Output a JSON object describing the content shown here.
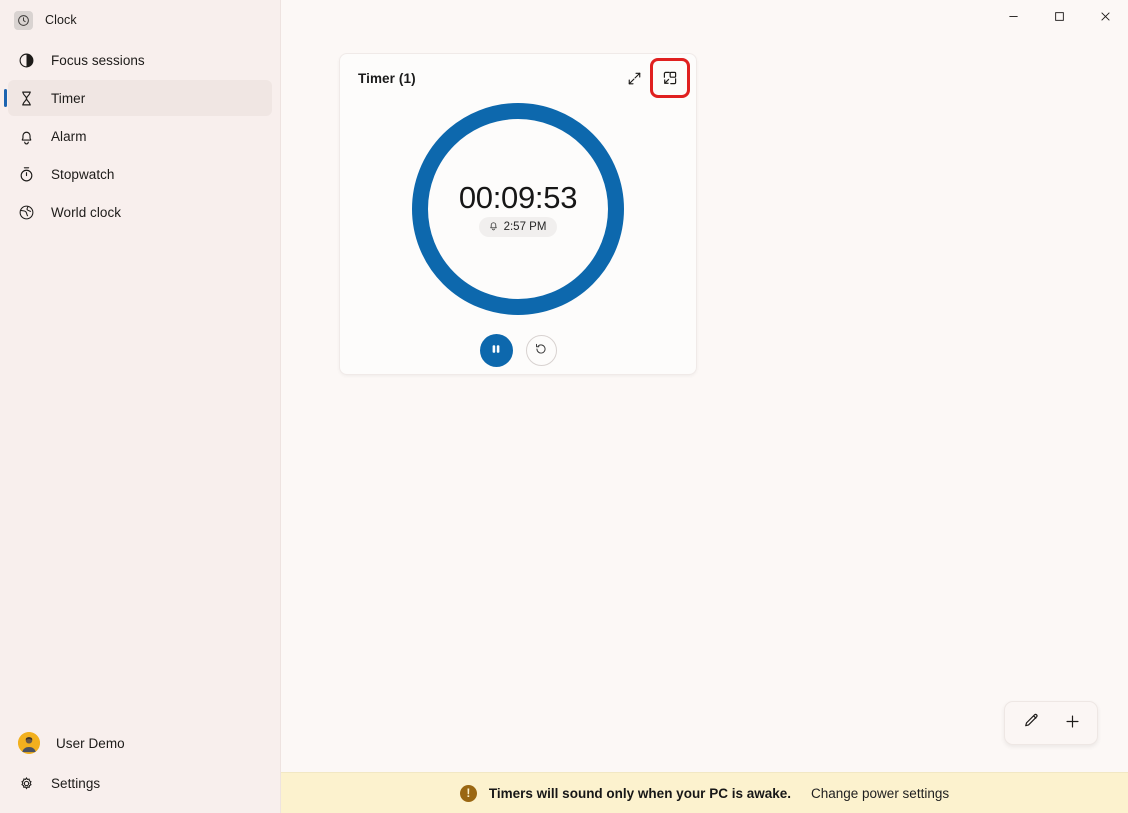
{
  "window": {
    "app_title": "Clock",
    "app_icon": "clock-app-icon",
    "controls": {
      "minimize": "minimize-icon",
      "maximize": "maximize-icon",
      "close": "close-icon"
    }
  },
  "sidebar": {
    "items": [
      {
        "label": "Focus sessions",
        "icon": "focus-sessions-icon",
        "selected": false
      },
      {
        "label": "Timer",
        "icon": "timer-hourglass-icon",
        "selected": true
      },
      {
        "label": "Alarm",
        "icon": "alarm-bell-icon",
        "selected": false
      },
      {
        "label": "Stopwatch",
        "icon": "stopwatch-icon",
        "selected": false
      },
      {
        "label": "World clock",
        "icon": "world-clock-globe-icon",
        "selected": false
      }
    ],
    "account": {
      "label": "User Demo",
      "icon": "user-avatar"
    },
    "settings": {
      "label": "Settings",
      "icon": "gear-icon"
    }
  },
  "timer_card": {
    "title": "Timer (1)",
    "time": "00:09:53",
    "alarm_time": "2:57 PM",
    "alarm_icon": "bell-icon",
    "expand_icon": "expand-diagonal-icon",
    "compact_overlay_icon": "compact-overlay-icon",
    "compact_overlay_highlighted": true,
    "pause_icon": "pause-icon",
    "reset_icon": "reset-counterclockwise-icon",
    "ring_color": "#0d68ad",
    "highlight_color": "#e02020"
  },
  "fab": {
    "edit_icon": "pencil-edit-icon",
    "add_icon": "plus-add-icon"
  },
  "statusbar": {
    "warning_icon": "warning-exclamation-icon",
    "message": "Timers will sound only when your PC is awake.",
    "link": "Change power settings",
    "background": "#fcf2ce"
  }
}
